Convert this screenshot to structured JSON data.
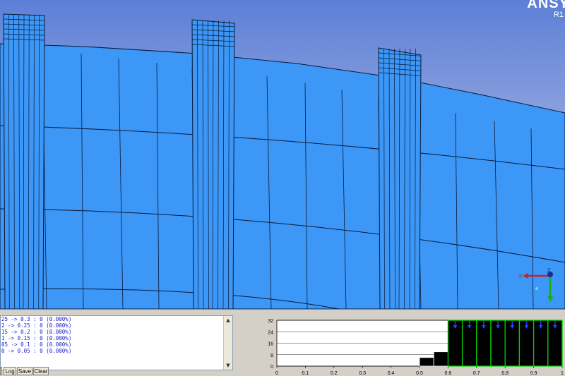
{
  "viewport": {
    "brand": "ANSY",
    "release": "R1",
    "axis_x_label": "X",
    "axis_z_label": "Z"
  },
  "log": {
    "lines": [
      "25 -> 0.3 : 0 (0.000%)",
      "2 -> 0.25 : 0 (0.000%)",
      "15 -> 0.2 : 0 (0.000%)",
      "1 -> 0.15 : 0 (0.000%)",
      "05 -> 0.1 : 0 (0.000%)",
      "0 -> 0.05 : 0 (0.000%)"
    ],
    "buttons": {
      "log": "Log",
      "save": "Save",
      "clear": "Clear"
    }
  },
  "colors": {
    "mesh_fill": "#3c97f6",
    "mesh_line": "#0a1a3a",
    "hist_bar": "#000000",
    "hist_selected_border": "#00d000",
    "hist_marker": "#2040ff"
  },
  "chart_data": {
    "type": "bar",
    "title": "",
    "xlabel": "",
    "ylabel": "",
    "x_ticks": [
      "0",
      "0.1",
      "0.2",
      "0.3",
      "0.4",
      "0.5",
      "0.6",
      "0.7",
      "0.8",
      "0.9",
      "1"
    ],
    "y_ticks": [
      "0",
      "8",
      "16",
      "24",
      "32"
    ],
    "xlim": [
      0,
      1
    ],
    "ylim": [
      0,
      32
    ],
    "bin_width": 0.05,
    "bins": [
      0.0,
      0.05,
      0.1,
      0.15,
      0.2,
      0.25,
      0.3,
      0.35,
      0.4,
      0.45,
      0.5,
      0.55,
      0.6,
      0.65,
      0.7,
      0.75,
      0.8,
      0.85,
      0.9,
      0.95
    ],
    "values": [
      0,
      0,
      0,
      0,
      0,
      0,
      0,
      0,
      0,
      0,
      6,
      10,
      32,
      32,
      32,
      32,
      32,
      32,
      32,
      32
    ],
    "selected_from": 0.6,
    "grid": true
  }
}
